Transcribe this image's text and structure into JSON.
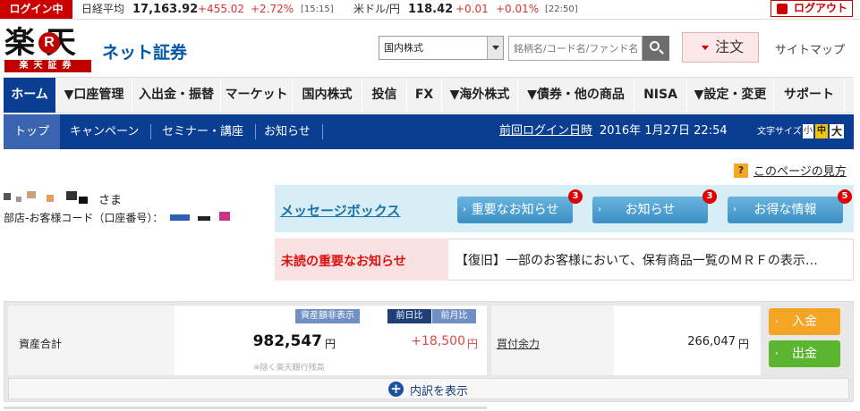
{
  "ticker": {
    "login_status": "ログイン中",
    "nikkei_label": "日経平均",
    "nikkei_value": "17,163.92",
    "nikkei_change": "+455.02",
    "nikkei_pct": "+2.72%",
    "nikkei_time": "[15:15]",
    "usdjpy_label": "米ドル/円",
    "usdjpy_value": "118.42",
    "usdjpy_change": "+0.01",
    "usdjpy_pct": "+0.01%",
    "usdjpy_time": "[22:50]",
    "logout_label": "ログアウト",
    "up_color": "#dd3333"
  },
  "header": {
    "logo_main": "楽 天",
    "logo_r": "R",
    "logo_sub": "楽天証券",
    "service_name": "ネット証券",
    "market_select_value": "国内株式",
    "search_placeholder": "銘柄名/コード名/ファンド名",
    "order_label": "注文",
    "sitemap_label": "サイトマップ",
    "brand_color": "#bf0000"
  },
  "main_nav": {
    "items": [
      {
        "label": "ホーム"
      },
      {
        "label": "▼口座管理"
      },
      {
        "label": "入出金・振替"
      },
      {
        "label": "マーケット"
      },
      {
        "label": "国内株式"
      },
      {
        "label": "投信"
      },
      {
        "label": "FX"
      },
      {
        "label": "▼海外株式"
      },
      {
        "label": "▼債券・他の商品"
      },
      {
        "label": "NISA"
      },
      {
        "label": "▼設定・変更"
      },
      {
        "label": "サポート"
      }
    ],
    "active_color": "#0a3e93"
  },
  "sub_nav": {
    "items": [
      {
        "label": "トップ"
      },
      {
        "label": "キャンペーン"
      },
      {
        "label": "セミナー・講座"
      },
      {
        "label": "お知らせ"
      }
    ],
    "last_login_label": "前回ログイン日時",
    "last_login_value": "2016年 1月27日 22:54",
    "font_size_label": "文字サイズ",
    "font_sizes": [
      "小",
      "中",
      "大"
    ]
  },
  "help": {
    "icon": "?",
    "label": "このページの見方"
  },
  "user": {
    "honorific": "さま",
    "code_label": "部店-お客様コード（口座番号）："
  },
  "messages": {
    "title": "メッセージボックス",
    "buttons": [
      {
        "label": "重要なお知らせ",
        "count": "3"
      },
      {
        "label": "お知らせ",
        "count": "3"
      },
      {
        "label": "お得な情報",
        "count": "5"
      }
    ],
    "unread_label": "未読の重要なお知らせ",
    "unread_text": "【復旧】一部のお客様において、保有商品一覧のＭＲＦの表示…"
  },
  "assets": {
    "label": "資産合計",
    "hide_label": "資産額非表示",
    "cmp_day": "前日比",
    "cmp_month": "前月比",
    "total": "982,547",
    "unit": "円",
    "change": "+18,500",
    "note": "※除く楽天銀行残高",
    "buying_power_label": "買付余力",
    "buying_power_value": "266,047",
    "deposit_label": "入金",
    "withdraw_label": "出金",
    "breakdown_icon": "+",
    "breakdown_label": "内訳を表示"
  }
}
